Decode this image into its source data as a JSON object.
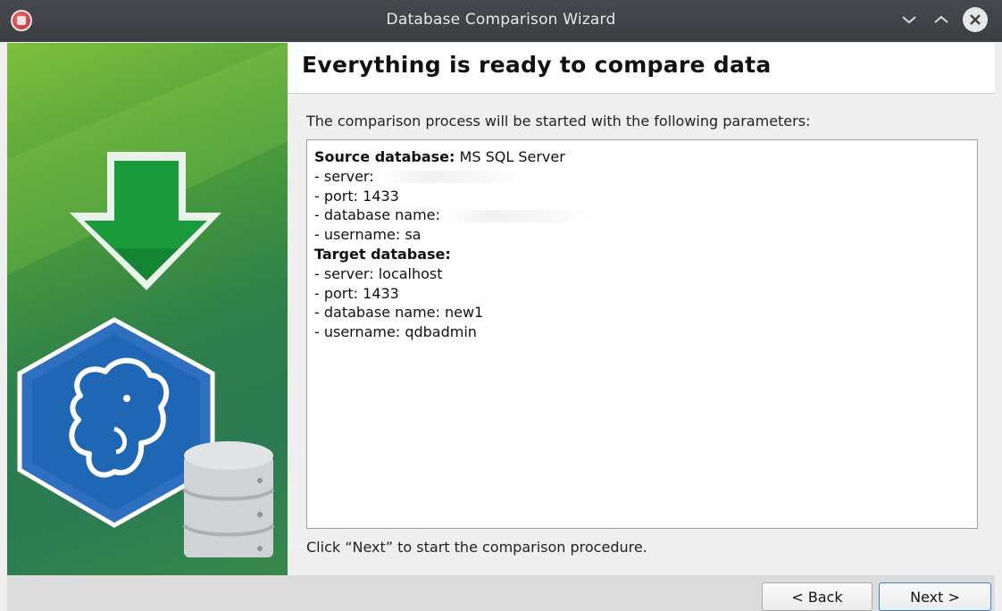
{
  "window": {
    "title": "Database Comparison Wizard"
  },
  "titlebar_icons": {
    "app": "app-icon",
    "minimize": "chevron-down-icon",
    "maximize": "chevron-up-icon",
    "close": "close-icon"
  },
  "page": {
    "heading": "Everything is ready to compare data",
    "intro": "The comparison process will be started with the following parameters:",
    "footer_note": "Click “Next” to start the comparison procedure."
  },
  "params": {
    "source_label": "Source database:",
    "source_value": "MS SQL Server",
    "source_lines": [
      "- server:",
      "- port: 1433",
      "- database name:",
      "- username: sa"
    ],
    "target_label": "Target database:",
    "target_lines": [
      "- server: localhost",
      "- port: 1433",
      "- database name: new1",
      "- username: qdbadmin"
    ]
  },
  "buttons": {
    "back": "< Back",
    "next": "Next >"
  },
  "colors": {
    "banner_green": "#2f8049",
    "arrow_green": "#0f9a39",
    "hexagon_blue": "#1f67b4",
    "titlebar": "#3b3f44"
  }
}
